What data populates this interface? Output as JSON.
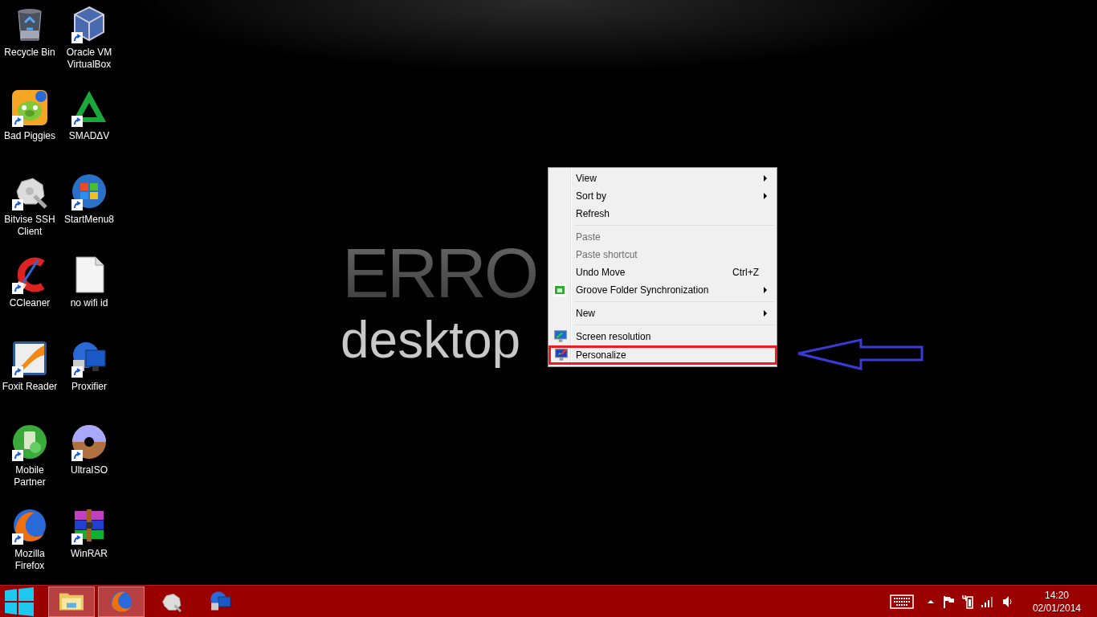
{
  "wallpaper": {
    "headline": "ERRO",
    "subline": "desktop"
  },
  "desktop_icons": [
    {
      "label": "Recycle Bin",
      "shortcut": false
    },
    {
      "label": "Bad Piggies",
      "shortcut": true
    },
    {
      "label": "Bitvise SSH Client",
      "shortcut": true
    },
    {
      "label": "CCleaner",
      "shortcut": true
    },
    {
      "label": "Foxit Reader",
      "shortcut": true
    },
    {
      "label": "Mobile Partner",
      "shortcut": true
    },
    {
      "label": "Mozilla Firefox",
      "shortcut": true
    },
    {
      "label": "Oracle VM VirtualBox",
      "shortcut": true
    },
    {
      "label": "SMADΔV",
      "shortcut": true
    },
    {
      "label": "StartMenu8",
      "shortcut": true
    },
    {
      "label": "no wifi id",
      "shortcut": false
    },
    {
      "label": "Proxifier",
      "shortcut": true
    },
    {
      "label": "UltraISO",
      "shortcut": true
    },
    {
      "label": "WinRAR",
      "shortcut": true
    }
  ],
  "context_menu": {
    "groups": [
      [
        {
          "label": "View",
          "submenu": true,
          "disabled": false,
          "highlighted": false
        },
        {
          "label": "Sort by",
          "submenu": true,
          "disabled": false,
          "highlighted": false
        },
        {
          "label": "Refresh",
          "submenu": false,
          "disabled": false,
          "highlighted": false
        }
      ],
      [
        {
          "label": "Paste",
          "submenu": false,
          "disabled": true,
          "highlighted": false
        },
        {
          "label": "Paste shortcut",
          "submenu": false,
          "disabled": true,
          "highlighted": false
        },
        {
          "label": "Undo Move",
          "shortcut": "Ctrl+Z",
          "submenu": false,
          "disabled": false,
          "highlighted": false
        },
        {
          "label": "Groove Folder Synchronization",
          "submenu": true,
          "disabled": false,
          "highlighted": false
        }
      ],
      [
        {
          "label": "New",
          "submenu": true,
          "disabled": false,
          "highlighted": false
        }
      ],
      [
        {
          "label": "Screen resolution",
          "submenu": false,
          "disabled": false,
          "highlighted": false
        },
        {
          "label": "Personalize",
          "submenu": false,
          "disabled": false,
          "highlighted": true
        }
      ]
    ]
  },
  "taskbar": {
    "items": [
      {
        "running": true
      },
      {
        "running": true
      },
      {
        "running": false
      },
      {
        "running": false
      }
    ],
    "clock": {
      "time": "14:20",
      "date": "02/01/2014"
    }
  }
}
